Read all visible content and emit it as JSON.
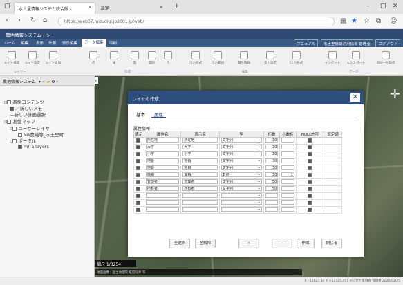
{
  "browser": {
    "tab1_title": "水土里情報システム統合版 -",
    "tab2_title": "設定",
    "url": "https://web07.mizudigi.jp2001.jp/web/",
    "new_tab": "+"
  },
  "app": {
    "title": "農地情報システム・シー",
    "menu": [
      "ホーム",
      "編集",
      "表示",
      "計測",
      "表示編集",
      "データ編集",
      "印刷"
    ],
    "active_menu_index": 5,
    "user_buttons": [
      "マニュアル",
      "水土里情報活用協会 管理者",
      "ログアウト"
    ]
  },
  "ribbon": {
    "buttons": [
      "レイヤ構成",
      "レイヤ設定",
      "レイヤ追加",
      "点",
      "線",
      "面",
      "図形",
      "円",
      "出力形式",
      "出力範囲",
      "属性情報",
      "出力設定",
      "出力形式",
      "インポート",
      "エクスポート",
      "領域一括操作"
    ],
    "groups": [
      "レイヤー",
      "作成",
      "編集",
      "データ"
    ]
  },
  "sidebar": {
    "header": "農地情報システム",
    "tree": [
      {
        "label": "基盤コンテンツ",
        "indent": 0,
        "check": false,
        "prefix": "▫"
      },
      {
        "label": "／新しいメモ",
        "indent": 1,
        "check": true,
        "prefix": ""
      },
      {
        "label": "新しい計画選択",
        "indent": 1,
        "check": false,
        "prefix": "—"
      },
      {
        "label": "基盤マップ",
        "indent": 0,
        "check": false,
        "prefix": "▫"
      },
      {
        "label": "ユーザーレイヤ",
        "indent": 1,
        "check": false,
        "prefix": "▫"
      },
      {
        "label": "NR農地等_水土里町",
        "indent": 2,
        "check": false,
        "prefix": ""
      },
      {
        "label": "ポータル",
        "indent": 1,
        "check": false,
        "prefix": "▫"
      },
      {
        "label": "ml_allayers",
        "indent": 2,
        "check": true,
        "prefix": ""
      }
    ]
  },
  "map": {
    "scale": "縮尺 1/3254",
    "attribution": "地図画像：国土地理院 航空写真 等"
  },
  "status": {
    "coords": "X: -12027.34  Y: +13725.457 m  |  水土里協会 管理者 2020/03/25"
  },
  "dialog": {
    "title": "レイヤの作成",
    "tabs": [
      "基本",
      "属性"
    ],
    "active_tab": 1,
    "section": "属性情報",
    "columns": [
      "表示",
      "属性名",
      "表示名",
      "型",
      "桁数",
      "小数桁",
      "NULL許可",
      "既定値"
    ],
    "rows": [
      {
        "show": true,
        "name": "所在地",
        "label": "所在地",
        "type": "文字列",
        "len": "30",
        "dec": "",
        "nullok": true
      },
      {
        "show": true,
        "name": "大字",
        "label": "大字",
        "type": "文字列",
        "len": "30",
        "dec": "",
        "nullok": true
      },
      {
        "show": true,
        "name": "小字",
        "label": "小字",
        "type": "文字列",
        "len": "30",
        "dec": "",
        "nullok": true
      },
      {
        "show": true,
        "name": "地番",
        "label": "地番",
        "type": "文字列",
        "len": "30",
        "dec": "",
        "nullok": true
      },
      {
        "show": true,
        "name": "地目",
        "label": "地目",
        "type": "文字列",
        "len": "30",
        "dec": "",
        "nullok": true
      },
      {
        "show": true,
        "name": "面積",
        "label": "面積",
        "type": "数値",
        "len": "30",
        "dec": "1",
        "nullok": true
      },
      {
        "show": true,
        "name": "管理者",
        "label": "管理者",
        "type": "文字列",
        "len": "50",
        "dec": "",
        "nullok": true
      },
      {
        "show": true,
        "name": "所有者",
        "label": "所有者",
        "type": "文字列",
        "len": "50",
        "dec": "",
        "nullok": true
      },
      {
        "show": true,
        "name": "",
        "label": "",
        "type": "",
        "len": "",
        "dec": "",
        "nullok": true
      },
      {
        "show": true,
        "name": "",
        "label": "",
        "type": "",
        "len": "",
        "dec": "",
        "nullok": true
      },
      {
        "show": true,
        "name": "",
        "label": "",
        "type": "",
        "len": "",
        "dec": "",
        "nullok": true
      }
    ],
    "buttons": {
      "select_all": "全選択",
      "deselect_all": "全解除",
      "add": "+",
      "remove": "−",
      "create": "作成",
      "close": "閉じる"
    }
  }
}
